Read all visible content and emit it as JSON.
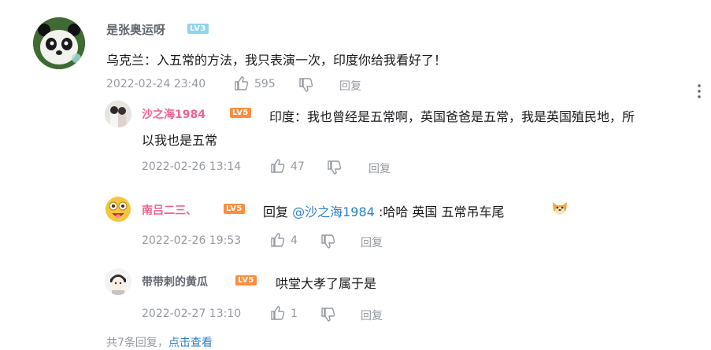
{
  "comments": [
    {
      "username": "是张奥运呀",
      "level": "LV3",
      "content": "乌克兰：入五常的方法，我只表演一次，印度你给我看好了！",
      "time": "2022-02-24 23:40",
      "likes": "595",
      "reply_label": "回复"
    }
  ],
  "replies": [
    {
      "username": "沙之海1984",
      "level": "LV5",
      "content_line1": "印度：我也曾经是五常啊，英国爸爸是五常，我是英国殖民地，所",
      "content_line2": "以我也是五常",
      "time": "2022-02-26 13:14",
      "likes": "47",
      "reply_label": "回复"
    },
    {
      "username": "南吕二三、",
      "level": "LV5",
      "reply_prefix": "回复",
      "mention": "@沙之海1984",
      "content": ":哈哈 英国 五常吊车尾",
      "time": "2022-02-26 19:53",
      "likes": "4",
      "reply_label": "回复"
    },
    {
      "username": "带带刺的黄瓜",
      "level": "LV5",
      "content": "哄堂大孝了属于是",
      "time": "2022-02-27 13:10",
      "likes": "1",
      "reply_label": "回复"
    }
  ],
  "footer": {
    "count_text": "共7条回复，",
    "view_link": "点击查看"
  },
  "colors": {
    "lv3": "#8ed2f0",
    "lv5": "#ff8c3c",
    "pink_name": "#f06292",
    "mention": "#2b7fc9",
    "meta": "#9499a0"
  },
  "icons": [
    "more-vertical-icon",
    "thumb-up-icon",
    "thumb-down-icon",
    "dog-emoji-icon"
  ]
}
